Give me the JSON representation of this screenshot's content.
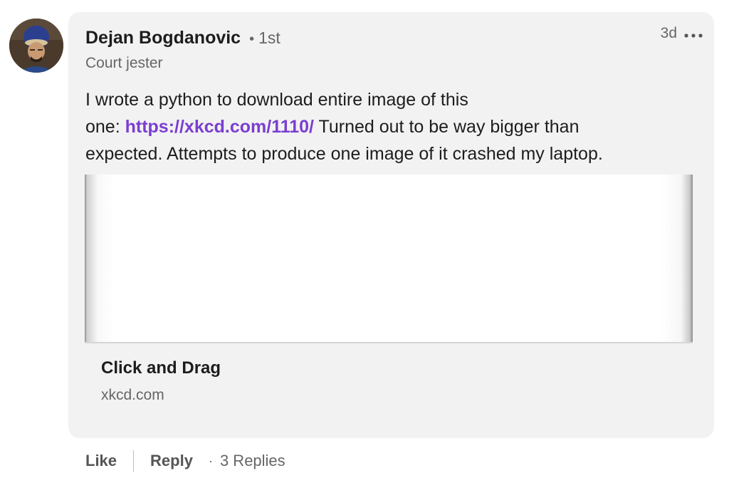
{
  "comment": {
    "author": {
      "name": "Dejan Bogdanovic",
      "degree_separator": "•",
      "degree": "1st",
      "headline": "Court jester"
    },
    "timestamp": "3d",
    "more_icon": "more-horizontal-icon",
    "body": {
      "line1": "I wrote a python to download entire image of this",
      "line2_prefix": "one: ",
      "link_text": "https://xkcd.com/1110/",
      "line2_suffix": " Turned out to be way bigger than",
      "line3": "expected. Attempts to produce one image of it crashed my laptop."
    },
    "link_preview": {
      "title": "Click and Drag",
      "domain": "xkcd.com"
    },
    "actions": {
      "like_label": "Like",
      "reply_label": "Reply",
      "dot": "·",
      "replies_label": "3 Replies"
    },
    "colors": {
      "bubble_background": "#f2f2f2",
      "link": "#7a3ed1",
      "secondary_text": "#666666"
    }
  }
}
